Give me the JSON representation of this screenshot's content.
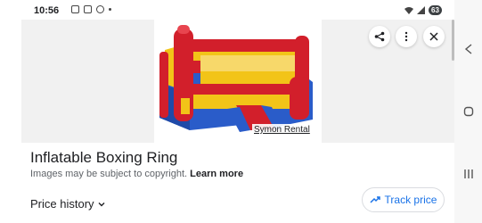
{
  "status": {
    "time": "10:56",
    "battery": "63"
  },
  "image": {
    "credit": "Symon Rental"
  },
  "product": {
    "title": "Inflatable Boxing Ring",
    "copyright_note": "Images may be subject to copyright.",
    "learn_more": "Learn more",
    "price_history": "Price history",
    "track_price": "Track price"
  },
  "colors": {
    "accent": "#1a73e8",
    "ring_red": "#d21f2b",
    "ring_blue": "#2a5cc9",
    "ring_yellow": "#f2c418"
  },
  "icons": [
    "share-icon",
    "more-vert-icon",
    "close-icon",
    "chevron-down-icon",
    "trend-icon",
    "back-icon",
    "home-icon",
    "recents-icon"
  ]
}
